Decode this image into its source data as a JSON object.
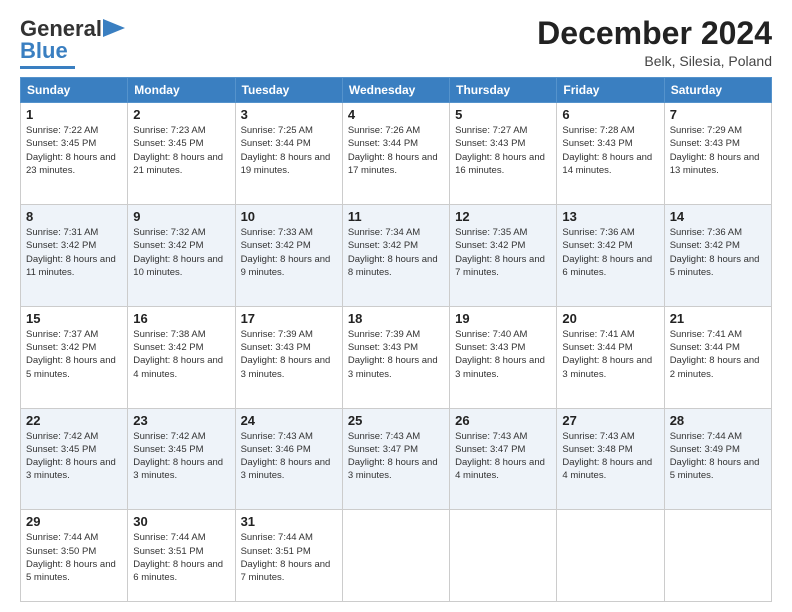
{
  "logo": {
    "line1": "General",
    "line2": "Blue"
  },
  "title": "December 2024",
  "location": "Belk, Silesia, Poland",
  "days_of_week": [
    "Sunday",
    "Monday",
    "Tuesday",
    "Wednesday",
    "Thursday",
    "Friday",
    "Saturday"
  ],
  "weeks": [
    [
      {
        "day": "1",
        "sunrise": "Sunrise: 7:22 AM",
        "sunset": "Sunset: 3:45 PM",
        "daylight": "Daylight: 8 hours and 23 minutes."
      },
      {
        "day": "2",
        "sunrise": "Sunrise: 7:23 AM",
        "sunset": "Sunset: 3:45 PM",
        "daylight": "Daylight: 8 hours and 21 minutes."
      },
      {
        "day": "3",
        "sunrise": "Sunrise: 7:25 AM",
        "sunset": "Sunset: 3:44 PM",
        "daylight": "Daylight: 8 hours and 19 minutes."
      },
      {
        "day": "4",
        "sunrise": "Sunrise: 7:26 AM",
        "sunset": "Sunset: 3:44 PM",
        "daylight": "Daylight: 8 hours and 17 minutes."
      },
      {
        "day": "5",
        "sunrise": "Sunrise: 7:27 AM",
        "sunset": "Sunset: 3:43 PM",
        "daylight": "Daylight: 8 hours and 16 minutes."
      },
      {
        "day": "6",
        "sunrise": "Sunrise: 7:28 AM",
        "sunset": "Sunset: 3:43 PM",
        "daylight": "Daylight: 8 hours and 14 minutes."
      },
      {
        "day": "7",
        "sunrise": "Sunrise: 7:29 AM",
        "sunset": "Sunset: 3:43 PM",
        "daylight": "Daylight: 8 hours and 13 minutes."
      }
    ],
    [
      {
        "day": "8",
        "sunrise": "Sunrise: 7:31 AM",
        "sunset": "Sunset: 3:42 PM",
        "daylight": "Daylight: 8 hours and 11 minutes."
      },
      {
        "day": "9",
        "sunrise": "Sunrise: 7:32 AM",
        "sunset": "Sunset: 3:42 PM",
        "daylight": "Daylight: 8 hours and 10 minutes."
      },
      {
        "day": "10",
        "sunrise": "Sunrise: 7:33 AM",
        "sunset": "Sunset: 3:42 PM",
        "daylight": "Daylight: 8 hours and 9 minutes."
      },
      {
        "day": "11",
        "sunrise": "Sunrise: 7:34 AM",
        "sunset": "Sunset: 3:42 PM",
        "daylight": "Daylight: 8 hours and 8 minutes."
      },
      {
        "day": "12",
        "sunrise": "Sunrise: 7:35 AM",
        "sunset": "Sunset: 3:42 PM",
        "daylight": "Daylight: 8 hours and 7 minutes."
      },
      {
        "day": "13",
        "sunrise": "Sunrise: 7:36 AM",
        "sunset": "Sunset: 3:42 PM",
        "daylight": "Daylight: 8 hours and 6 minutes."
      },
      {
        "day": "14",
        "sunrise": "Sunrise: 7:36 AM",
        "sunset": "Sunset: 3:42 PM",
        "daylight": "Daylight: 8 hours and 5 minutes."
      }
    ],
    [
      {
        "day": "15",
        "sunrise": "Sunrise: 7:37 AM",
        "sunset": "Sunset: 3:42 PM",
        "daylight": "Daylight: 8 hours and 5 minutes."
      },
      {
        "day": "16",
        "sunrise": "Sunrise: 7:38 AM",
        "sunset": "Sunset: 3:42 PM",
        "daylight": "Daylight: 8 hours and 4 minutes."
      },
      {
        "day": "17",
        "sunrise": "Sunrise: 7:39 AM",
        "sunset": "Sunset: 3:43 PM",
        "daylight": "Daylight: 8 hours and 3 minutes."
      },
      {
        "day": "18",
        "sunrise": "Sunrise: 7:39 AM",
        "sunset": "Sunset: 3:43 PM",
        "daylight": "Daylight: 8 hours and 3 minutes."
      },
      {
        "day": "19",
        "sunrise": "Sunrise: 7:40 AM",
        "sunset": "Sunset: 3:43 PM",
        "daylight": "Daylight: 8 hours and 3 minutes."
      },
      {
        "day": "20",
        "sunrise": "Sunrise: 7:41 AM",
        "sunset": "Sunset: 3:44 PM",
        "daylight": "Daylight: 8 hours and 3 minutes."
      },
      {
        "day": "21",
        "sunrise": "Sunrise: 7:41 AM",
        "sunset": "Sunset: 3:44 PM",
        "daylight": "Daylight: 8 hours and 2 minutes."
      }
    ],
    [
      {
        "day": "22",
        "sunrise": "Sunrise: 7:42 AM",
        "sunset": "Sunset: 3:45 PM",
        "daylight": "Daylight: 8 hours and 3 minutes."
      },
      {
        "day": "23",
        "sunrise": "Sunrise: 7:42 AM",
        "sunset": "Sunset: 3:45 PM",
        "daylight": "Daylight: 8 hours and 3 minutes."
      },
      {
        "day": "24",
        "sunrise": "Sunrise: 7:43 AM",
        "sunset": "Sunset: 3:46 PM",
        "daylight": "Daylight: 8 hours and 3 minutes."
      },
      {
        "day": "25",
        "sunrise": "Sunrise: 7:43 AM",
        "sunset": "Sunset: 3:47 PM",
        "daylight": "Daylight: 8 hours and 3 minutes."
      },
      {
        "day": "26",
        "sunrise": "Sunrise: 7:43 AM",
        "sunset": "Sunset: 3:47 PM",
        "daylight": "Daylight: 8 hours and 4 minutes."
      },
      {
        "day": "27",
        "sunrise": "Sunrise: 7:43 AM",
        "sunset": "Sunset: 3:48 PM",
        "daylight": "Daylight: 8 hours and 4 minutes."
      },
      {
        "day": "28",
        "sunrise": "Sunrise: 7:44 AM",
        "sunset": "Sunset: 3:49 PM",
        "daylight": "Daylight: 8 hours and 5 minutes."
      }
    ],
    [
      {
        "day": "29",
        "sunrise": "Sunrise: 7:44 AM",
        "sunset": "Sunset: 3:50 PM",
        "daylight": "Daylight: 8 hours and 5 minutes."
      },
      {
        "day": "30",
        "sunrise": "Sunrise: 7:44 AM",
        "sunset": "Sunset: 3:51 PM",
        "daylight": "Daylight: 8 hours and 6 minutes."
      },
      {
        "day": "31",
        "sunrise": "Sunrise: 7:44 AM",
        "sunset": "Sunset: 3:51 PM",
        "daylight": "Daylight: 8 hours and 7 minutes."
      },
      null,
      null,
      null,
      null
    ]
  ]
}
